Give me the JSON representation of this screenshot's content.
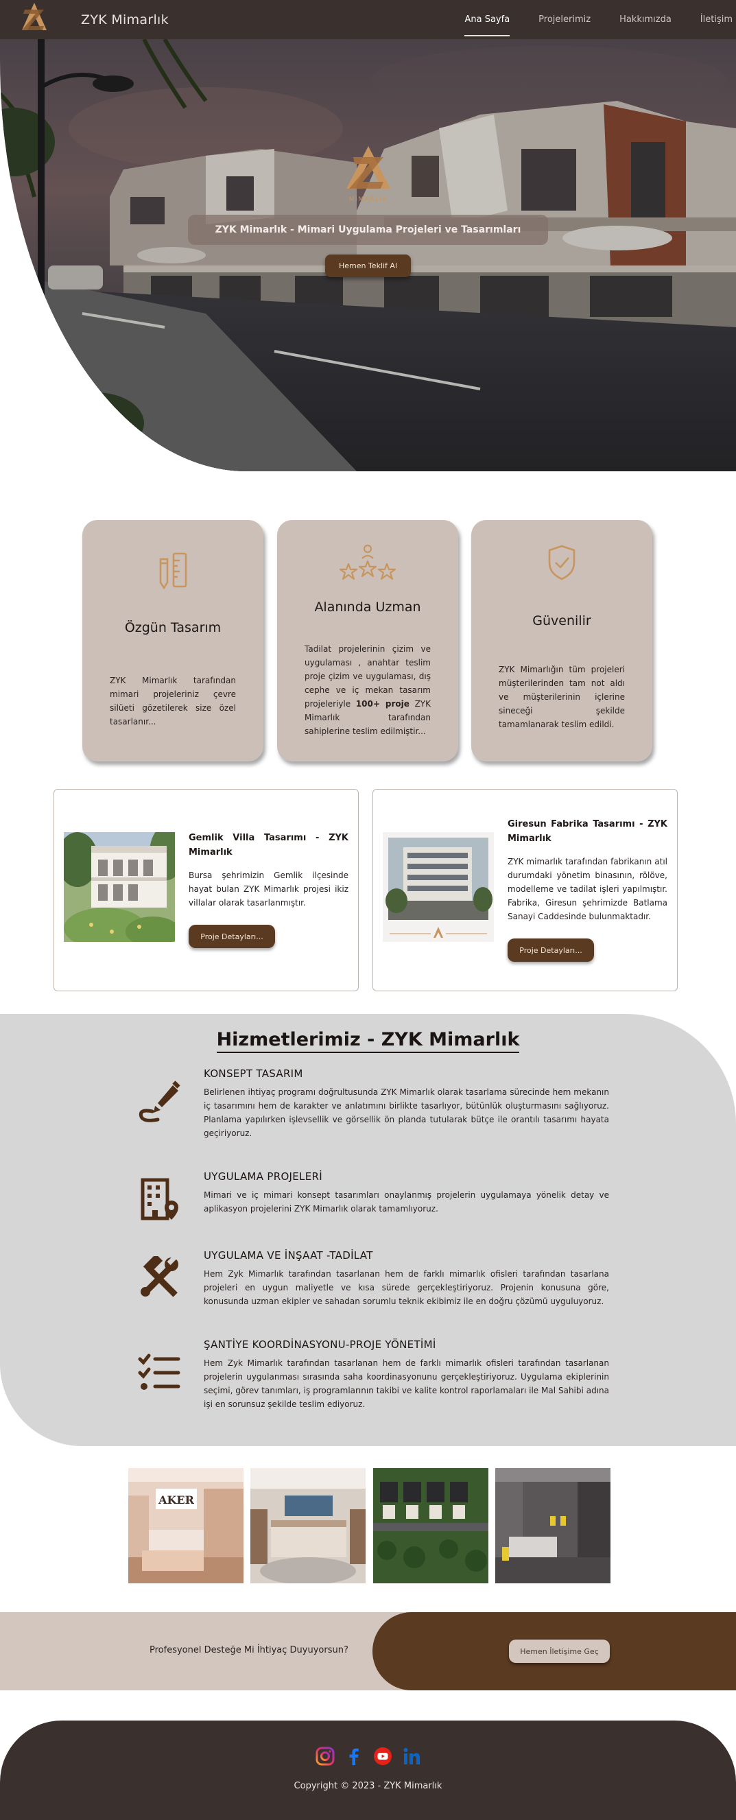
{
  "nav": {
    "brand": "ZYK Mimarlık",
    "links": [
      "Ana Sayfa",
      "Projelerimiz",
      "Hakkımızda",
      "İletişim"
    ],
    "active": "Ana Sayfa"
  },
  "hero": {
    "logo_text": "MİMARLIK",
    "title": "ZYK Mimarlık - Mimari Uygulama Projeleri ve Tasarımları",
    "button": "Hemen Teklif Al"
  },
  "features": [
    {
      "icon": "pencil-ruler-icon",
      "title": "Özgün Tasarım",
      "text": "ZYK Mimarlık tarafından mimari projeleriniz çevre silüeti gözetilerek size özel tasarlanır..."
    },
    {
      "icon": "award-stars-icon",
      "title": "Alanında Uzman",
      "text_before": "Tadilat projelerinin çizim ve uygulaması , anahtar teslim proje çizim ve uygulaması, dış cephe ve iç mekan tasarım projeleriyle ",
      "text_bold": "100+ proje",
      "text_after": " ZYK Mimarlık tarafından sahiplerine teslim edilmiştir..."
    },
    {
      "icon": "shield-check-icon",
      "title": "Güvenilir",
      "text": "ZYK Mimarlığın tüm projeleri müşterilerinden tam not aldı ve müşterilerinin içlerine sineceği şekilde tamamlanarak teslim edildi."
    }
  ],
  "projects": [
    {
      "title": "Gemlik Villa Tasarımı - ZYK Mimarlık",
      "text": "Bursa şehrimizin Gemlik ilçesinde hayat bulan ZYK Mimarlık projesi ikiz villalar olarak tasarlanmıştır.",
      "button": "Proje Detayları..."
    },
    {
      "title": "Giresun Fabrika Tasarımı - ZYK Mimarlık",
      "text": "ZYK mimarlık tarafından fabrikanın atıl durumdaki yönetim binasının, rölöve, modelleme ve tadilat işleri yapılmıştır. Fabrika, Giresun şehrimizde Batlama Sanayi Caddesinde bulunmaktadır.",
      "button": "Proje Detayları..."
    }
  ],
  "services": {
    "title": "Hizmetlerimiz - ZYK Mimarlık",
    "items": [
      {
        "icon": "design-pen-icon",
        "title": "KONSEPT TASARIM",
        "text": "Belirlenen ihtiyaç programı doğrultusunda ZYK Mimarlık olarak tasarlama sürecinde hem mekanın iç tasarımını hem de karakter ve anlatımını birlikte tasarlıyor, bütünlük oluşturmasını sağlıyoruz. Planlama yapılırken işlevsellik ve görsellik ön planda tutularak bütçe ile orantılı tasarımı hayata geçiriyoruz."
      },
      {
        "icon": "building-location-icon",
        "title": "UYGULAMA PROJELERİ",
        "text": "Mimari ve iç mimari konsept tasarımları onaylanmış projelerin uygulamaya yönelik detay ve aplikasyon projelerini ZYK Mimarlık olarak tamamlıyoruz."
      },
      {
        "icon": "hammer-wrench-icon",
        "title": "UYGULAMA VE İNŞAAT -TADİLAT",
        "text": "Hem Zyk Mimarlık tarafından tasarlanan hem de farklı mimarlık ofisleri tarafından tasarlana projeleri en uygun maliyetle ve kısa sürede gerçekleştiriyoruz. Projenin konusuna göre, konusunda uzman ekipler ve sahadan sorumlu teknik ekibimiz ile en doğru çözümü uyguluyoruz."
      },
      {
        "icon": "checklist-icon",
        "title": "ŞANTİYE KOORDİNASYONU-PROJE YÖNETİMİ",
        "text": "Hem Zyk Mimarlık tarafından tasarlanan hem de farklı mimarlık ofisleri tarafından tasarlanan projelerin uygulanması sırasında saha koordinasyonunu gerçekleştiriyoruz. Uygulama ekiplerinin seçimi, görev tanımları, iş programlarının takibi ve kalite kontrol raporlamaları ile Mal Sahibi adına işi en sorunsuz şekilde teslim ediyoruz."
      }
    ]
  },
  "gallery": [
    "store-interior-image",
    "bedroom-interior-image",
    "aerial-villas-image",
    "living-room-interior-image"
  ],
  "gallery_sign": "AKER",
  "cta": {
    "text": "Profesyonel Desteğe Mi İhtiyaç Duyuyorsun?",
    "button": "Hemen İletişime Geç"
  },
  "footer": {
    "socials": [
      "instagram-icon",
      "facebook-icon",
      "youtube-icon",
      "linkedin-icon"
    ],
    "copyright": "Copyright © 2023 - ZYK Mimarlık"
  },
  "colors": {
    "nav_bg": "#3a312f",
    "card_bg": "#cbbfb8",
    "accent_brown": "#5a3a20",
    "services_bg": "#d6d6d6",
    "logo_gold": "#c8955e"
  }
}
